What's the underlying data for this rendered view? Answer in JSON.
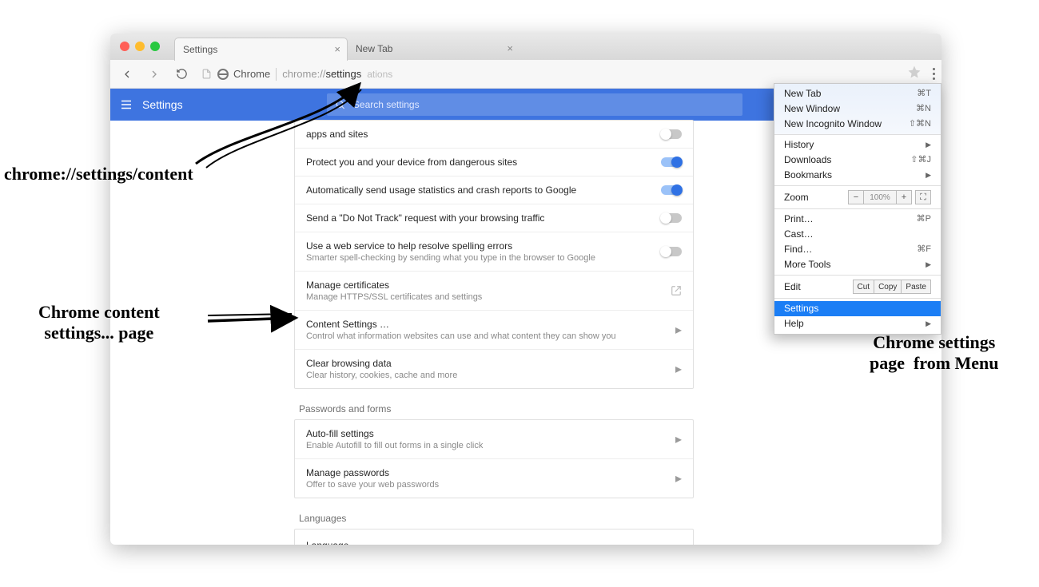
{
  "window": {
    "tabs": [
      {
        "title": "Settings"
      },
      {
        "title": "New Tab"
      }
    ]
  },
  "toolbar": {
    "chip": "Chrome",
    "address_prefix": "chrome://",
    "address_bold": "settings",
    "extra_text": "ations"
  },
  "bluebar": {
    "title": "Settings",
    "search_placeholder": "Search settings"
  },
  "privacy_rows": [
    {
      "label": "apps and sites",
      "sub": "",
      "right": "toggle",
      "on": false
    },
    {
      "label": "Protect you and your device from dangerous sites",
      "sub": "",
      "right": "toggle",
      "on": true
    },
    {
      "label": "Automatically send usage statistics and crash reports to Google",
      "sub": "",
      "right": "toggle",
      "on": true
    },
    {
      "label": "Send a \"Do Not Track\" request with your browsing traffic",
      "sub": "",
      "right": "toggle",
      "on": false
    },
    {
      "label": "Use a web service to help resolve spelling errors",
      "sub": "Smarter spell-checking by sending what you type in the browser to Google",
      "right": "toggle",
      "on": false
    },
    {
      "label": "Manage certificates",
      "sub": "Manage HTTPS/SSL certificates and settings",
      "right": "ext"
    },
    {
      "label": "Content Settings …",
      "sub": "Control what information websites can use and what content they can show you",
      "right": "chev"
    },
    {
      "label": "Clear browsing data",
      "sub": "Clear history, cookies, cache and more",
      "right": "chev"
    }
  ],
  "passwords": {
    "title": "Passwords and forms",
    "rows": [
      {
        "label": "Auto-fill settings",
        "sub": "Enable Autofill to fill out forms in a single click",
        "right": "chev"
      },
      {
        "label": "Manage passwords",
        "sub": "Offer to save your web passwords",
        "right": "chev"
      }
    ]
  },
  "languages": {
    "title": "Languages",
    "rows": [
      {
        "label": "Language",
        "sub": "",
        "right": "expand"
      }
    ]
  },
  "menu": {
    "top": [
      {
        "label": "New Tab",
        "kb": "⌘T"
      },
      {
        "label": "New Window",
        "kb": "⌘N"
      },
      {
        "label": "New Incognito Window",
        "kb": "⇧⌘N"
      }
    ],
    "hist": [
      {
        "label": "History",
        "arw": true
      },
      {
        "label": "Downloads",
        "kb": "⇧⌘J"
      },
      {
        "label": "Bookmarks",
        "arw": true
      }
    ],
    "zoom": {
      "label": "Zoom",
      "value": "100%"
    },
    "tools": [
      {
        "label": "Print…",
        "kb": "⌘P"
      },
      {
        "label": "Cast…"
      },
      {
        "label": "Find…",
        "kb": "⌘F"
      },
      {
        "label": "More Tools",
        "arw": true
      }
    ],
    "edit": {
      "label": "Edit",
      "btns": [
        "Cut",
        "Copy",
        "Paste"
      ]
    },
    "bottom": [
      {
        "label": "Settings",
        "hi": true
      },
      {
        "label": "Help",
        "arw": true
      }
    ]
  },
  "annotations": {
    "url": "chrome://settings/content",
    "content": "Chrome content\nsettings... page",
    "menu": "Chrome settings\npage  from Menu"
  }
}
